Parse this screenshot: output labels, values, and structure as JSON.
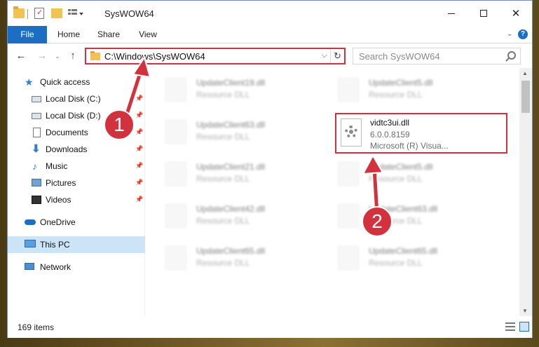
{
  "window": {
    "title": "SysWOW64",
    "status_count": "169 items"
  },
  "ribbon": {
    "tabs": [
      "File",
      "Home",
      "Share",
      "View"
    ]
  },
  "address": {
    "path": "C:\\Windows\\SysWOW64",
    "search_placeholder": "Search SysWOW64"
  },
  "sidebar": {
    "items": [
      {
        "label": "Quick access"
      },
      {
        "label": "Local Disk (C:)"
      },
      {
        "label": "Local Disk (D:)"
      },
      {
        "label": "Documents"
      },
      {
        "label": "Downloads"
      },
      {
        "label": "Music"
      },
      {
        "label": "Pictures"
      },
      {
        "label": "Videos"
      },
      {
        "label": "OneDrive"
      },
      {
        "label": "This PC"
      },
      {
        "label": "Network"
      }
    ]
  },
  "files": [
    {
      "name": "UpdateClient19.dll",
      "sub": "Resource DLL"
    },
    {
      "name": "UpdateClient5.dll",
      "sub": "Resource DLL"
    },
    {
      "name": "UpdateClient63.dll",
      "sub": "Resource DLL"
    },
    {
      "name": "vidtc3ui.dll",
      "version": "6.0.0.8159",
      "sub": "Microsoft (R) Visua..."
    },
    {
      "name": "UpdateClient21.dll",
      "sub": "Resource DLL"
    },
    {
      "name": "UpdateClient5.dll",
      "sub": "Resource DLL"
    },
    {
      "name": "UpdateClient42.dll",
      "sub": "Resource DLL"
    },
    {
      "name": "UpdateClient63.dll",
      "sub": "Resource DLL"
    },
    {
      "name": "UpdateClient65.dll",
      "sub": "Resource DLL"
    },
    {
      "name": "UpdateClient65.dll",
      "sub": "Resource DLL"
    }
  ],
  "annotations": {
    "step1": "1",
    "step2": "2"
  },
  "colors": {
    "accent": "#1a6fc4",
    "highlight_red": "#d2323e",
    "selection": "#cce4f7"
  }
}
